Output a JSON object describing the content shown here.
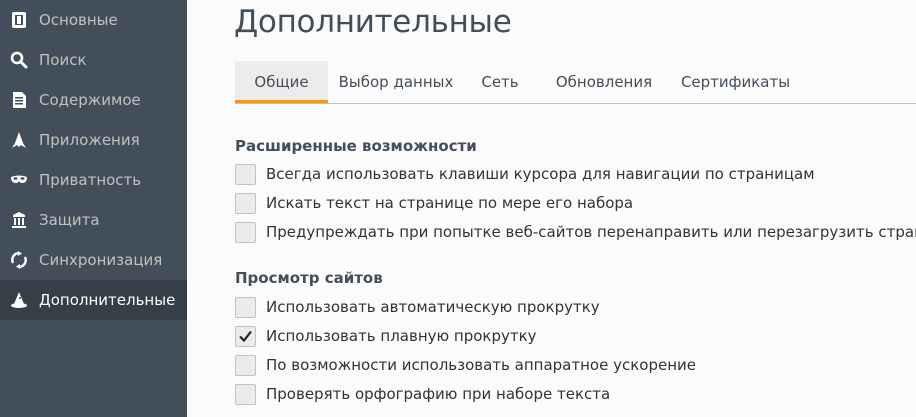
{
  "sidebar": {
    "items": [
      {
        "label": "Основные",
        "icon": "general-icon",
        "active": false
      },
      {
        "label": "Поиск",
        "icon": "search-icon",
        "active": false
      },
      {
        "label": "Содержимое",
        "icon": "content-icon",
        "active": false
      },
      {
        "label": "Приложения",
        "icon": "applications-icon",
        "active": false
      },
      {
        "label": "Приватность",
        "icon": "privacy-mask-icon",
        "active": false
      },
      {
        "label": "Защита",
        "icon": "security-icon",
        "active": false
      },
      {
        "label": "Синхронизация",
        "icon": "sync-icon",
        "active": false
      },
      {
        "label": "Дополнительные",
        "icon": "advanced-wizard-icon",
        "active": true
      }
    ]
  },
  "main": {
    "title": "Дополнительные",
    "tabs": [
      {
        "label": "Общие",
        "active": true
      },
      {
        "label": "Выбор данных",
        "active": false
      },
      {
        "label": "Сеть",
        "active": false
      },
      {
        "label": "Обновления",
        "active": false
      },
      {
        "label": "Сертификаты",
        "active": false
      }
    ],
    "accessibility": {
      "title": "Расширенные возможности",
      "options": [
        {
          "label": "Всегда использовать клавиши курсора для навигации по страницам",
          "checked": false
        },
        {
          "label": "Искать текст на странице по мере его набора",
          "checked": false
        },
        {
          "label": "Предупреждать при попытке веб-сайтов перенаправить или перезагрузить страницу",
          "checked": false
        }
      ]
    },
    "browsing": {
      "title": "Просмотр сайтов",
      "options": [
        {
          "label": "Использовать автоматическую прокрутку",
          "checked": false
        },
        {
          "label": "Использовать плавную прокрутку",
          "checked": true
        },
        {
          "label": "По возможности использовать аппаратное ускорение",
          "checked": false
        },
        {
          "label": "Проверять орфографию при наборе текста",
          "checked": false
        }
      ]
    }
  },
  "colors": {
    "sidebar_bg": "#424f5a",
    "sidebar_active_bg": "#343f48",
    "tab_accent": "#ff9500",
    "text": "#424e5a"
  }
}
